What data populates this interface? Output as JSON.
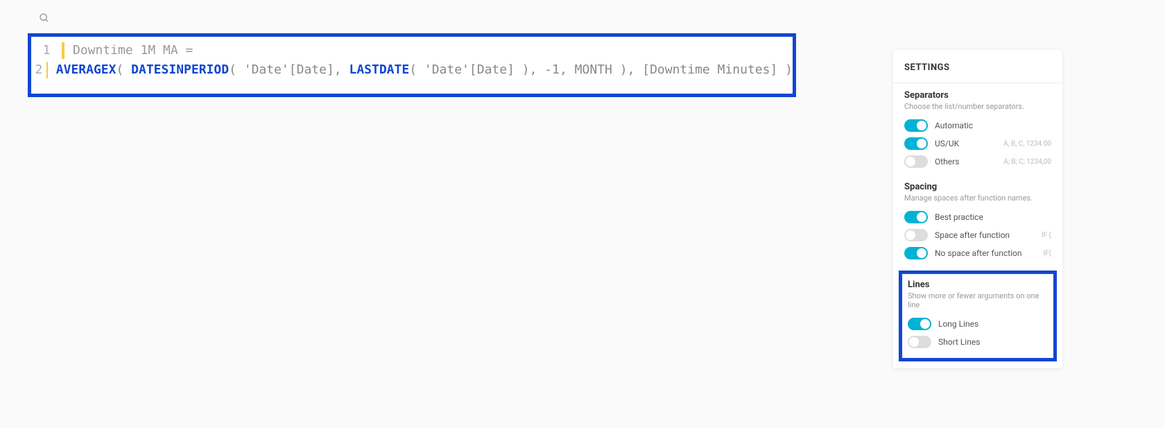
{
  "search": {
    "placeholder": ""
  },
  "editor": {
    "line1_num": "1",
    "line2_num": "2",
    "measure_name": "Downtime 1M MA =",
    "func_averagex": "AVERAGEX",
    "paren_open1": "( ",
    "func_datesinperiod": "DATESINPERIOD",
    "paren_open2": "( ",
    "ref_date1": "'Date'[Date]",
    "comma1": ", ",
    "func_lastdate": "LASTDATE",
    "paren_open3": "( ",
    "ref_date2": "'Date'[Date]",
    "paren_close1": " )",
    "comma2": ", ",
    "neg1": "-1",
    "comma3": ", ",
    "kw_month": "MONTH",
    "paren_close2": " )",
    "comma4": ", ",
    "ref_downtime": "[Downtime Minutes]",
    "paren_close3": " )"
  },
  "settings": {
    "title": "SETTINGS",
    "separators": {
      "title": "Separators",
      "sub": "Choose the list/number separators.",
      "automatic": "Automatic",
      "usuk": "US/UK",
      "usuk_hint": "A, B, C, 1234.00",
      "others": "Others",
      "others_hint": "A; B; C; 1234,00"
    },
    "spacing": {
      "title": "Spacing",
      "sub": "Manage spaces after function names.",
      "best": "Best practice",
      "space_after": "Space after function",
      "space_after_hint": "IF (",
      "no_space": "No space after function",
      "no_space_hint": "IF("
    },
    "lines": {
      "title": "Lines",
      "sub": "Show more or fewer arguments on one line",
      "long": "Long Lines",
      "short": "Short Lines"
    }
  }
}
